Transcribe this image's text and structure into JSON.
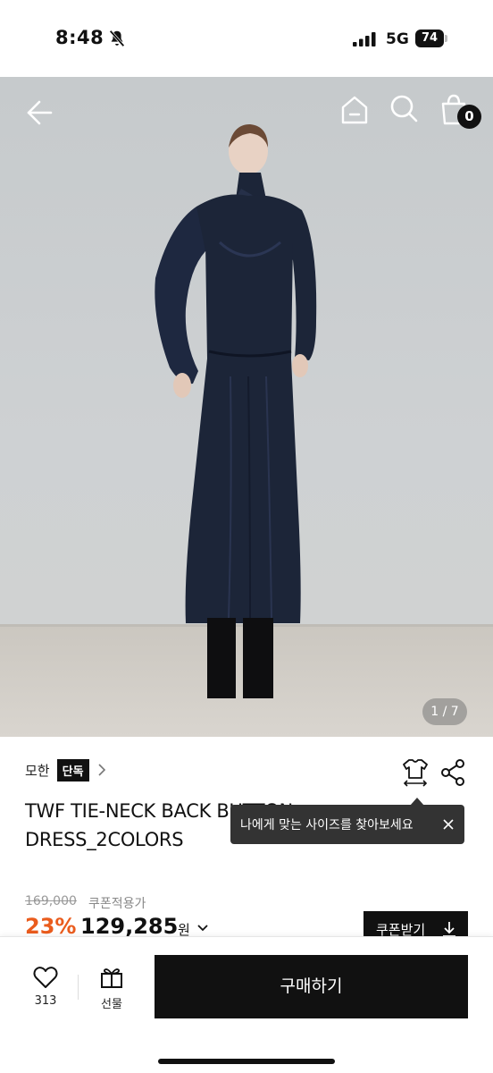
{
  "status_bar": {
    "time": "8:48",
    "network": "5G",
    "battery": "74",
    "icons": [
      "bell-off-icon",
      "signal-icon",
      "battery-icon"
    ]
  },
  "hero": {
    "counter": "1 / 7",
    "icons": [
      "back-arrow-icon",
      "home-icon",
      "search-icon",
      "shopping-bag-icon"
    ],
    "cart_count": "0"
  },
  "product": {
    "brand": "모한",
    "brand_tag": "단독",
    "title_line1": "TWF TIE-NECK BACK BUTTON",
    "title_line2": "DRESS_2COLORS",
    "size_icon": "size-guide-shirt-icon",
    "share_icon": "share-icon"
  },
  "tooltip": {
    "text": "나에게 맞는 사이즈를 찾아보세요"
  },
  "price": {
    "original": "169,000",
    "coupon_note": "쿠폰적용가",
    "discount": "23%",
    "sale": "129,285",
    "unit": "원",
    "coupon_button": "쿠폰받기"
  },
  "bottom_bar": {
    "like_count": "313",
    "gift_label": "선물",
    "buy_label": "구매하기"
  },
  "colors": {
    "accent_discount": "#ea5c1d",
    "primary_button": "#111111",
    "dress": "#1c2538"
  }
}
